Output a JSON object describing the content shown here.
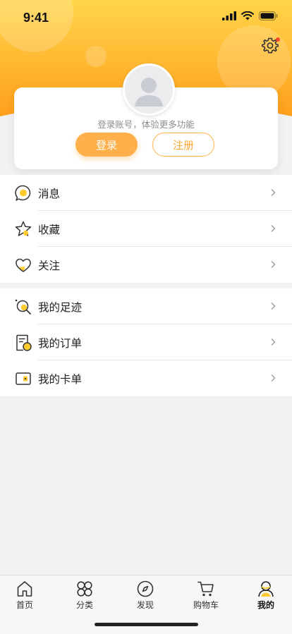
{
  "status_bar": {
    "time": "9:41"
  },
  "login_card": {
    "hint": "登录账号，体验更多功能",
    "login_label": "登录",
    "register_label": "注册"
  },
  "menu_group_1": [
    {
      "label": "消息",
      "icon": "message-icon"
    },
    {
      "label": "收藏",
      "icon": "star-icon"
    },
    {
      "label": "关注",
      "icon": "heart-icon"
    }
  ],
  "menu_group_2": [
    {
      "label": "我的足迹",
      "icon": "footprint-icon"
    },
    {
      "label": "我的订单",
      "icon": "order-icon"
    },
    {
      "label": "我的卡单",
      "icon": "card-icon"
    }
  ],
  "tab_bar": [
    {
      "label": "首页",
      "icon": "home-icon"
    },
    {
      "label": "分类",
      "icon": "category-icon"
    },
    {
      "label": "发现",
      "icon": "compass-icon"
    },
    {
      "label": "购物车",
      "icon": "cart-icon"
    },
    {
      "label": "我的",
      "icon": "profile-icon",
      "active": true
    }
  ],
  "colors": {
    "accent": "#ffb04a",
    "header_top": "#ffcf45",
    "header_bottom": "#ff9f1c",
    "icon_yellow": "#ffcb2f"
  }
}
